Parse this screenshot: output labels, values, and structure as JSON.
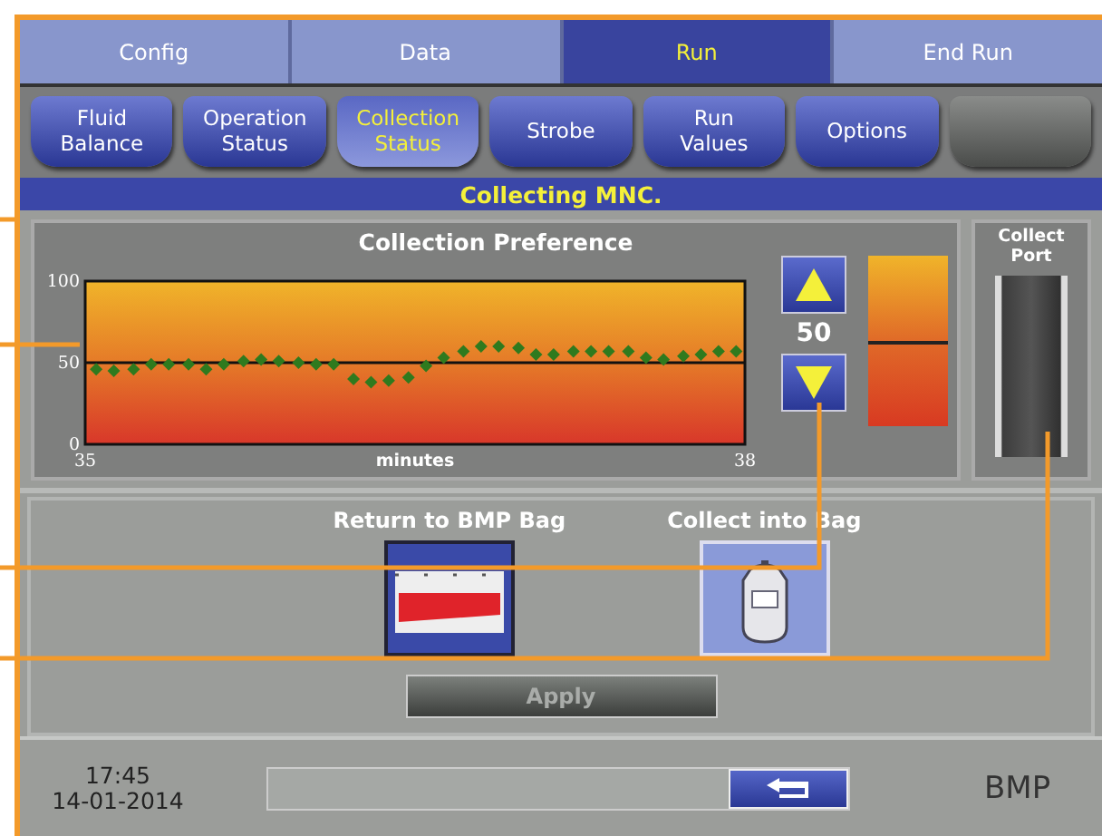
{
  "tabs": [
    {
      "label": "Config",
      "selected": false
    },
    {
      "label": "Data",
      "selected": false
    },
    {
      "label": "Run",
      "selected": true
    },
    {
      "label": "End Run",
      "selected": false
    }
  ],
  "subtabs": [
    {
      "label": "Fluid\nBalance",
      "selected": false,
      "disabled": false
    },
    {
      "label": "Operation\nStatus",
      "selected": false,
      "disabled": false
    },
    {
      "label": "Collection\nStatus",
      "selected": true,
      "disabled": false
    },
    {
      "label": "Strobe",
      "selected": false,
      "disabled": false
    },
    {
      "label": "Run\nValues",
      "selected": false,
      "disabled": false
    },
    {
      "label": "Options",
      "selected": false,
      "disabled": false
    },
    {
      "selected": false,
      "disabled": true
    }
  ],
  "banner": "Collecting MNC.",
  "preference": {
    "title": "Collection Preference",
    "value": "50",
    "level": 0.5,
    "chart_data": {
      "type": "scatter",
      "xlabel": "minutes",
      "xlim": [
        35,
        38
      ],
      "ylim": [
        0,
        100
      ],
      "xticks": [
        35,
        38
      ],
      "yticks": [
        0,
        50,
        100
      ],
      "series": [
        {
          "color": "#2f7a1e",
          "x": [
            35.05,
            35.13,
            35.22,
            35.3,
            35.38,
            35.47,
            35.55,
            35.63,
            35.72,
            35.8,
            35.88,
            35.97,
            36.05,
            36.13,
            36.22,
            36.3,
            36.38,
            36.47,
            36.55,
            36.63,
            36.72,
            36.8,
            36.88,
            36.97,
            37.05,
            37.13,
            37.22,
            37.3,
            37.38,
            37.47,
            37.55,
            37.63,
            37.72,
            37.8,
            37.88,
            37.96
          ],
          "values": [
            46,
            45,
            46,
            49,
            49,
            49,
            46,
            49,
            51,
            52,
            51,
            50,
            49,
            49,
            40,
            38,
            39,
            41,
            48,
            53,
            57,
            60,
            60,
            59,
            55,
            55,
            57,
            57,
            57,
            57,
            53,
            52,
            54,
            55,
            57,
            57
          ]
        }
      ]
    }
  },
  "port": {
    "title": "Collect\nPort"
  },
  "options": [
    {
      "label": "Return to BMP Bag",
      "kind": "return",
      "selected": false
    },
    {
      "label": "Collect into Bag",
      "kind": "bag",
      "selected": true
    }
  ],
  "apply": {
    "label": "Apply",
    "disabled": true
  },
  "footer": {
    "time": "17:45",
    "date": "14-01-2014",
    "mode": "BMP"
  }
}
